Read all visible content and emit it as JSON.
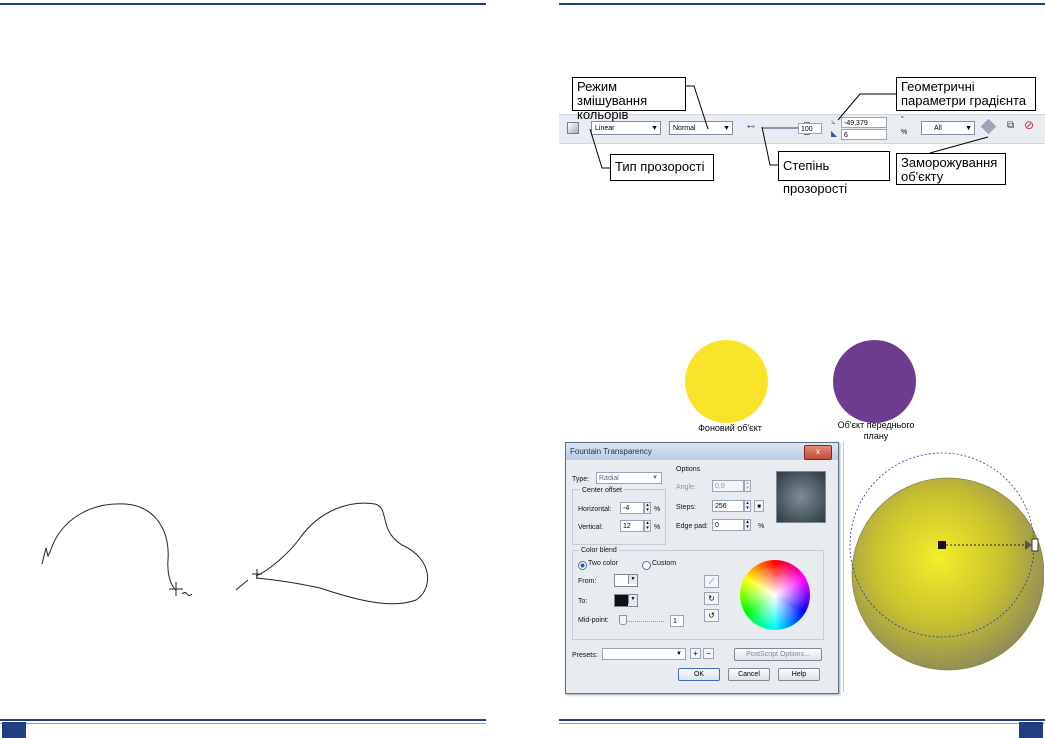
{
  "toolbar": {
    "type_value": "Linear",
    "mode_value": "Normal",
    "amount_value": "100",
    "geom_angle": "-49,379",
    "geom_edge": "6",
    "degree_unit": "°",
    "percent_unit": "%",
    "target_value": "All"
  },
  "callouts": {
    "blend_mode": "Режим змішування кольорів",
    "geometry": "Геометричні параметри градієнта",
    "transparency_type": "Тип прозорості",
    "transparency_degree": "Степінь прозорості",
    "freeze": "Заморожування об'єкту"
  },
  "circles": {
    "background_label": "Фоновий об'єкт",
    "foreground_label": "Об'єкт переднього плану",
    "background_color": "#f9e42a",
    "foreground_color": "#6e3c8f"
  },
  "dialog": {
    "title": "Fountain Transparency",
    "close": "x",
    "type_label": "Type:",
    "type_value": "Radial",
    "center_offset": "Center offset",
    "horizontal_label": "Horizontal:",
    "horizontal_value": "-4",
    "vertical_label": "Vertical:",
    "vertical_value": "12",
    "percent": "%",
    "options": "Options",
    "angle_label": "Angle:",
    "angle_value": "0,0",
    "steps_label": "Steps:",
    "steps_value": "256",
    "edge_pad_label": "Edge pad:",
    "edge_pad_value": "0",
    "color_blend": "Color blend",
    "two_color": "Two color",
    "custom": "Custom",
    "from_label": "From:",
    "to_label": "To:",
    "midpoint_label": "Mid-point:",
    "midpoint_value": "1",
    "presets_label": "Presets:",
    "postscript": "PostScript Options...",
    "ok": "OK",
    "cancel": "Cancel",
    "help": "Help"
  }
}
